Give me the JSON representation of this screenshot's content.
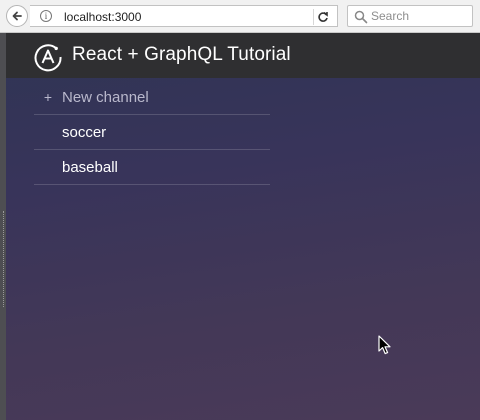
{
  "browser": {
    "url": "localhost:3000",
    "search_placeholder": "Search",
    "info_glyph": "i"
  },
  "app": {
    "title": "React + GraphQL Tutorial",
    "new_channel_plus": "+",
    "new_channel_label": "New channel",
    "channels": [
      {
        "name": "soccer"
      },
      {
        "name": "baseball"
      }
    ]
  },
  "icons": {
    "back": "back-arrow-icon",
    "info": "info-icon",
    "reload": "reload-icon",
    "search": "search-icon",
    "logo": "apollo-logo-icon",
    "cursor": "mouse-cursor-icon"
  },
  "colors": {
    "header_bg": "#2f2f31",
    "page_gradient_top": "#2f3554",
    "page_gradient_bottom": "#4a3a58",
    "text": "#ffffff",
    "muted_text": "#b9b8cc"
  }
}
